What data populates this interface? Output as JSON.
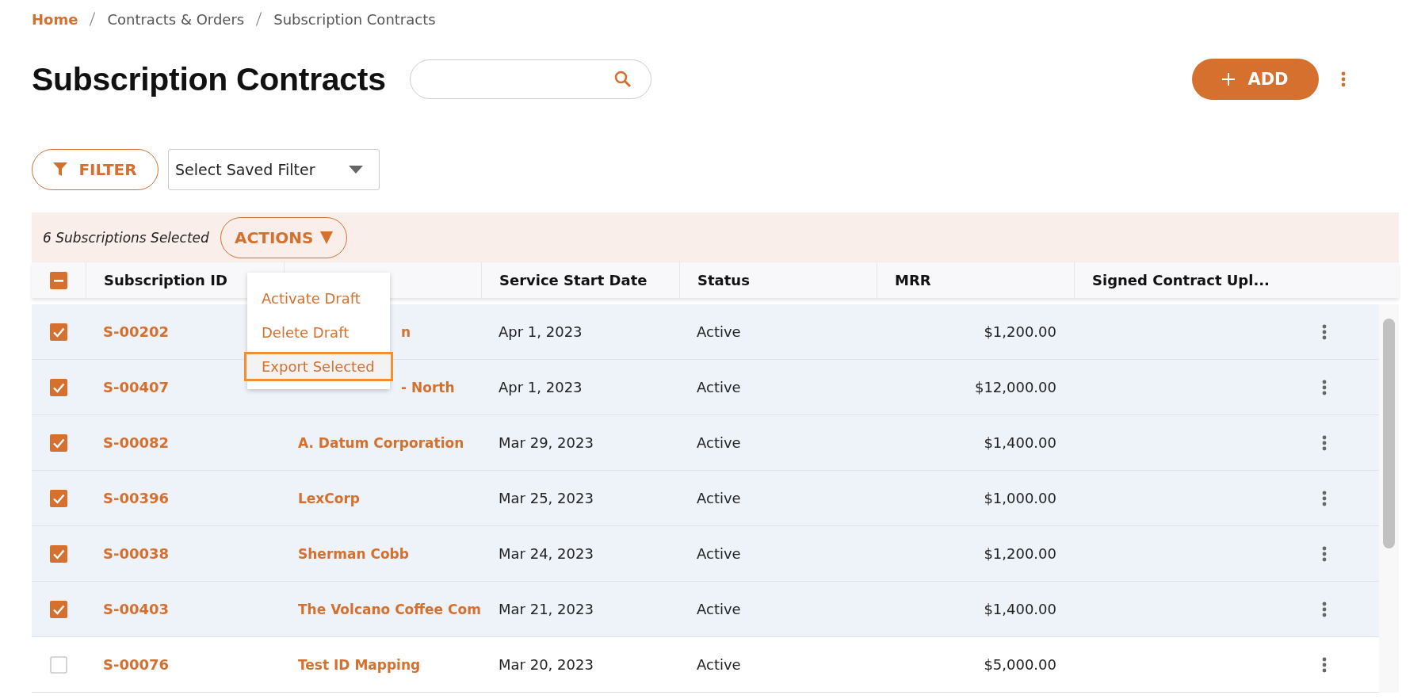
{
  "breadcrumb": [
    {
      "label": "Home",
      "kind": "link"
    },
    {
      "label": "Contracts & Orders",
      "kind": "text"
    },
    {
      "label": "Subscription Contracts",
      "kind": "text"
    }
  ],
  "page_title": "Subscription Contracts",
  "add_button": "ADD",
  "filter_button": "FILTER",
  "saved_filter": {
    "value": "Select Saved Filter"
  },
  "selection": {
    "summary": "6 Subscriptions Selected",
    "actions_button": "ACTIONS"
  },
  "actions_menu": [
    {
      "label": "Activate Draft",
      "selected": false
    },
    {
      "label": "Delete Draft",
      "selected": false
    },
    {
      "label": "Export Selected",
      "selected": true
    }
  ],
  "table": {
    "header_indeterminate": true,
    "columns": [
      {
        "label": "Subscription ID"
      },
      {},
      {
        "label": "Service Start Date"
      },
      {
        "label": "Status"
      },
      {
        "label": "MRR"
      },
      {
        "label": "Signed Contract Upl..."
      }
    ],
    "rows": [
      {
        "selected": true,
        "id": "S-00202",
        "name": "n",
        "name_partial": true,
        "date": "Apr 1, 2023",
        "status": "Active",
        "mrr": "$1,200.00"
      },
      {
        "selected": true,
        "id": "S-00407",
        "name": "- North",
        "name_partial": true,
        "date": "Apr 1, 2023",
        "status": "Active",
        "mrr": "$12,000.00"
      },
      {
        "selected": true,
        "id": "S-00082",
        "name": "A. Datum Corporation",
        "date": "Mar 29, 2023",
        "status": "Active",
        "mrr": "$1,400.00"
      },
      {
        "selected": true,
        "id": "S-00396",
        "name": "LexCorp",
        "date": "Mar 25, 2023",
        "status": "Active",
        "mrr": "$1,000.00"
      },
      {
        "selected": true,
        "id": "S-00038",
        "name": "Sherman Cobb",
        "date": "Mar 24, 2023",
        "status": "Active",
        "mrr": "$1,200.00"
      },
      {
        "selected": true,
        "id": "S-00403",
        "name": "The Volcano Coffee Com",
        "date": "Mar 21, 2023",
        "status": "Active",
        "mrr": "$1,400.00"
      },
      {
        "selected": false,
        "id": "S-00076",
        "name": "Test ID Mapping",
        "date": "Mar 20, 2023",
        "status": "Active",
        "mrr": "$5,000.00"
      }
    ]
  }
}
